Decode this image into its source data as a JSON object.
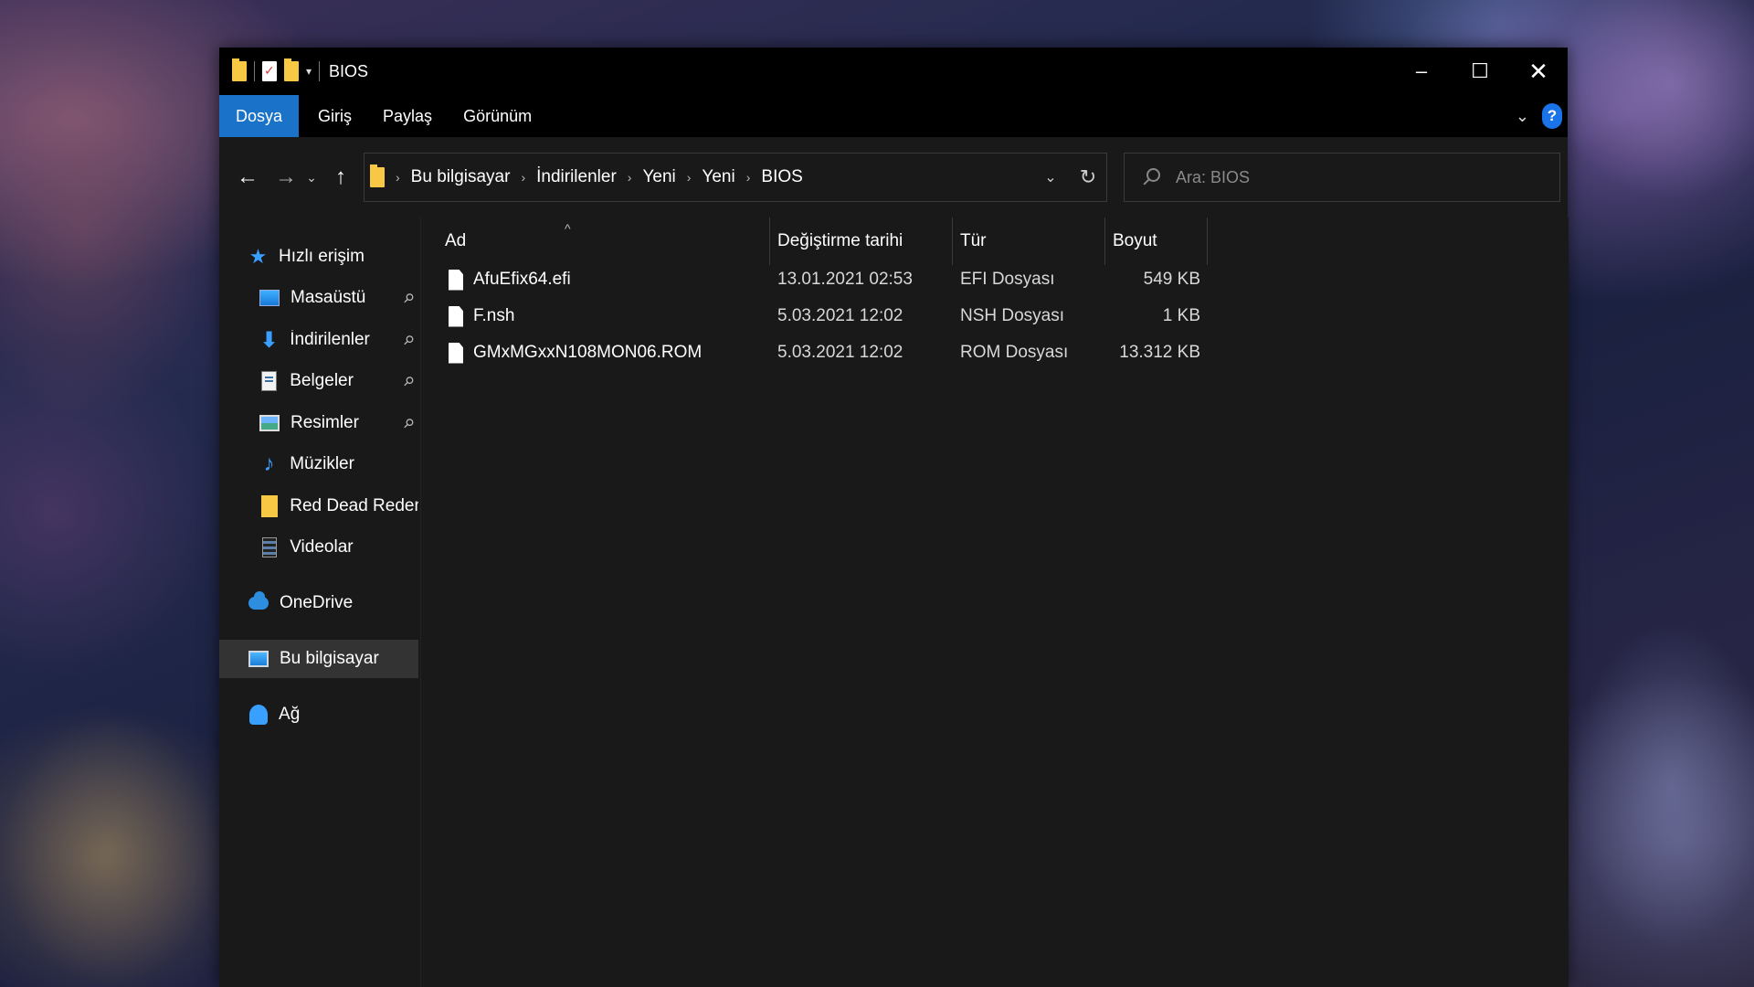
{
  "window": {
    "title": "BIOS",
    "qat_dropdown": "▾",
    "controls": {
      "minimize": "–",
      "maximize": "☐",
      "close": "✕"
    }
  },
  "ribbon": {
    "tabs": [
      {
        "label": "Dosya",
        "active": true
      },
      {
        "label": "Giriş"
      },
      {
        "label": "Paylaş"
      },
      {
        "label": "Görünüm"
      }
    ],
    "expand": "⌄",
    "help": "?"
  },
  "nav": {
    "back": "←",
    "forward": "→",
    "recent": "⌄",
    "up": "↑",
    "breadcrumb": [
      "Bu bilgisayar",
      "İndirilenler",
      "Yeni",
      "Yeni",
      "BIOS"
    ],
    "crumb_separator": "›",
    "address_dropdown": "⌄",
    "refresh": "↻",
    "search_placeholder": "Ara: BIOS"
  },
  "sidebar": {
    "quick_access": "Hızlı erişim",
    "items": [
      {
        "label": "Masaüstü",
        "pinned": true,
        "icon": "desktop-icon"
      },
      {
        "label": "İndirilenler",
        "pinned": true,
        "icon": "downloads-icon"
      },
      {
        "label": "Belgeler",
        "pinned": true,
        "icon": "documents-icon"
      },
      {
        "label": "Resimler",
        "pinned": true,
        "icon": "pictures-icon"
      },
      {
        "label": "Müzikler",
        "pinned": false,
        "icon": "music-icon"
      },
      {
        "label": "Red Dead Redempti",
        "pinned": false,
        "icon": "folder-icon"
      },
      {
        "label": "Videolar",
        "pinned": false,
        "icon": "videos-icon"
      }
    ],
    "onedrive": "OneDrive",
    "this_pc": "Bu bilgisayar",
    "network": "Ağ",
    "pin_glyph": "📌"
  },
  "files": {
    "sort_indicator": "^",
    "columns": {
      "name": "Ad",
      "modified": "Değiştirme tarihi",
      "type": "Tür",
      "size": "Boyut"
    },
    "rows": [
      {
        "name": "AfuEfix64.efi",
        "modified": "13.01.2021 02:53",
        "type": "EFI Dosyası",
        "size": "549 KB"
      },
      {
        "name": "F.nsh",
        "modified": "5.03.2021 12:02",
        "type": "NSH Dosyası",
        "size": "1 KB"
      },
      {
        "name": "GMxMGxxN108MON06.ROM",
        "modified": "5.03.2021 12:02",
        "type": "ROM Dosyası",
        "size": "13.312 KB"
      }
    ]
  },
  "colors": {
    "accent": "#1a73c9",
    "window_bg": "#191919",
    "titlebar_bg": "#000000",
    "selected": "#333333"
  }
}
